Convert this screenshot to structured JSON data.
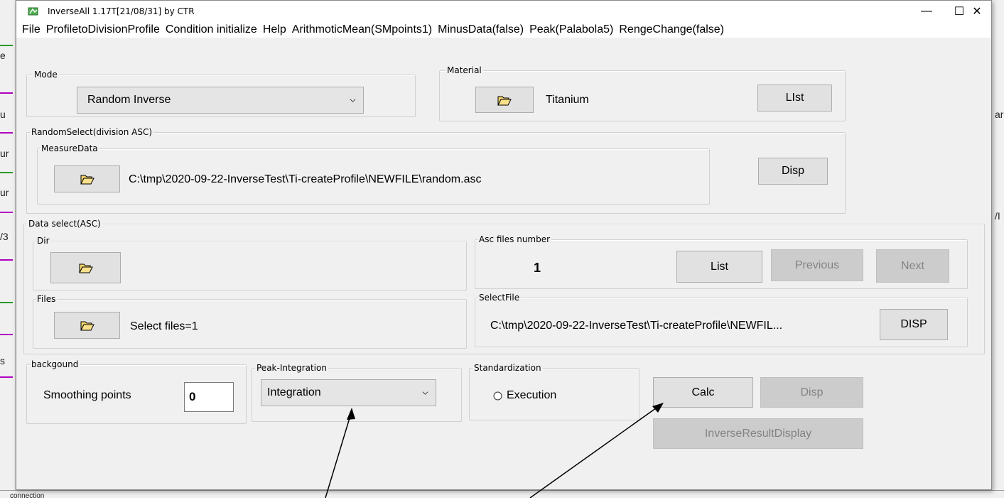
{
  "window": {
    "title": "InverseAll 1.17T[21/08/31] by CTR",
    "minimize_label": "—",
    "maximize_label": "☐",
    "close_label": "✕"
  },
  "menu": [
    "File",
    "ProfiletoDivisionProfile",
    "Condition initialize",
    "Help",
    "ArithmoticMean(SMpoints1)",
    "MinusData(false)",
    "Peak(Palabola5)",
    "RengeChange(false)"
  ],
  "mode": {
    "legend": "Mode",
    "value": "Random Inverse"
  },
  "material": {
    "legend": "Material",
    "value": "Titanium",
    "list_label": "LIst"
  },
  "random_select": {
    "legend": "RandomSelect(division ASC)",
    "measure_legend": "MeasureData",
    "path": "C:\\tmp\\2020-09-22-InverseTest\\Ti-createProfile\\NEWFILE\\random.asc",
    "disp_label": "Disp"
  },
  "data_select": {
    "legend": "Data select(ASC)",
    "dir_legend": "Dir",
    "files_legend": "Files",
    "files_text": "Select files=1",
    "asc_legend": "Asc files number",
    "asc_number": "1",
    "list_label": "List",
    "previous_label": "Previous",
    "next_label": "Next",
    "selectfile_legend": "SelectFile",
    "selectfile_path": "C:\\tmp\\2020-09-22-InverseTest\\Ti-createProfile\\NEWFIL...",
    "disp_label": "DISP"
  },
  "background": {
    "legend": "backgound",
    "smoothing_label": "Smoothing points",
    "smoothing_value": "0"
  },
  "peak": {
    "legend": "Peak-Integration",
    "value": "Integration"
  },
  "standardization": {
    "legend": "Standardization",
    "option_label": "Execution"
  },
  "actions": {
    "calc_label": "Calc",
    "disp_label": "Disp",
    "inverse_result_label": "InverseResultDisplay"
  },
  "background_window": {
    "left_texts": [
      "e",
      "u",
      "ur",
      "ur",
      "/3",
      "s"
    ],
    "right_texts": [
      "ar",
      "/I"
    ],
    "bottom_text": "connection"
  },
  "colors": {
    "accent_purple": "#b000c0",
    "accent_green": "#2a9a2a"
  },
  "icons": {
    "app": "paint-icon",
    "folder": "folder-open-icon"
  }
}
